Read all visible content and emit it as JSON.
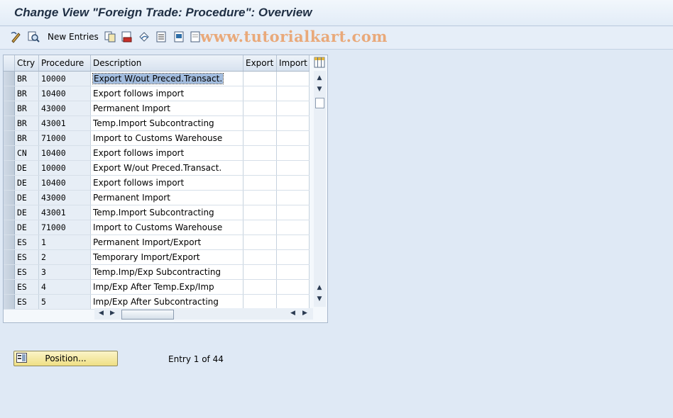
{
  "window": {
    "title": "Change View \"Foreign Trade: Procedure\": Overview"
  },
  "toolbar": {
    "new_entries_label": "New Entries",
    "watermark": "www.tutorialkart.com"
  },
  "table": {
    "columns": [
      "Ctry",
      "Procedure",
      "Description",
      "Export",
      "Import"
    ],
    "rows": [
      {
        "ctry": "BR",
        "procedure": "10000",
        "description": "Export W/out Preced.Transact."
      },
      {
        "ctry": "BR",
        "procedure": "10400",
        "description": "Export follows import"
      },
      {
        "ctry": "BR",
        "procedure": "43000",
        "description": "Permanent Import"
      },
      {
        "ctry": "BR",
        "procedure": "43001",
        "description": "Temp.Import Subcontracting"
      },
      {
        "ctry": "BR",
        "procedure": "71000",
        "description": "Import to Customs Warehouse"
      },
      {
        "ctry": "CN",
        "procedure": "10400",
        "description": "Export follows import"
      },
      {
        "ctry": "DE",
        "procedure": "10000",
        "description": "Export W/out Preced.Transact."
      },
      {
        "ctry": "DE",
        "procedure": "10400",
        "description": "Export follows import"
      },
      {
        "ctry": "DE",
        "procedure": "43000",
        "description": "Permanent Import"
      },
      {
        "ctry": "DE",
        "procedure": "43001",
        "description": "Temp.Import Subcontracting"
      },
      {
        "ctry": "DE",
        "procedure": "71000",
        "description": "Import to Customs Warehouse"
      },
      {
        "ctry": "ES",
        "procedure": "1",
        "description": "Permanent Import/Export"
      },
      {
        "ctry": "ES",
        "procedure": "2",
        "description": "Temporary Import/Export"
      },
      {
        "ctry": "ES",
        "procedure": "3",
        "description": "Temp.Imp/Exp Subcontracting"
      },
      {
        "ctry": "ES",
        "procedure": "4",
        "description": "Imp/Exp After Temp.Exp/Imp"
      },
      {
        "ctry": "ES",
        "procedure": "5",
        "description": "Imp/Exp After Subcontracting"
      }
    ],
    "selected_row": 0
  },
  "footer": {
    "position_button_label": "Position...",
    "entry_info": "Entry 1 of 44"
  },
  "colors": {
    "background": "#dfe9f5",
    "header": "#d7e2ef",
    "selection": "#a3bddf",
    "button": "#efdf84"
  }
}
